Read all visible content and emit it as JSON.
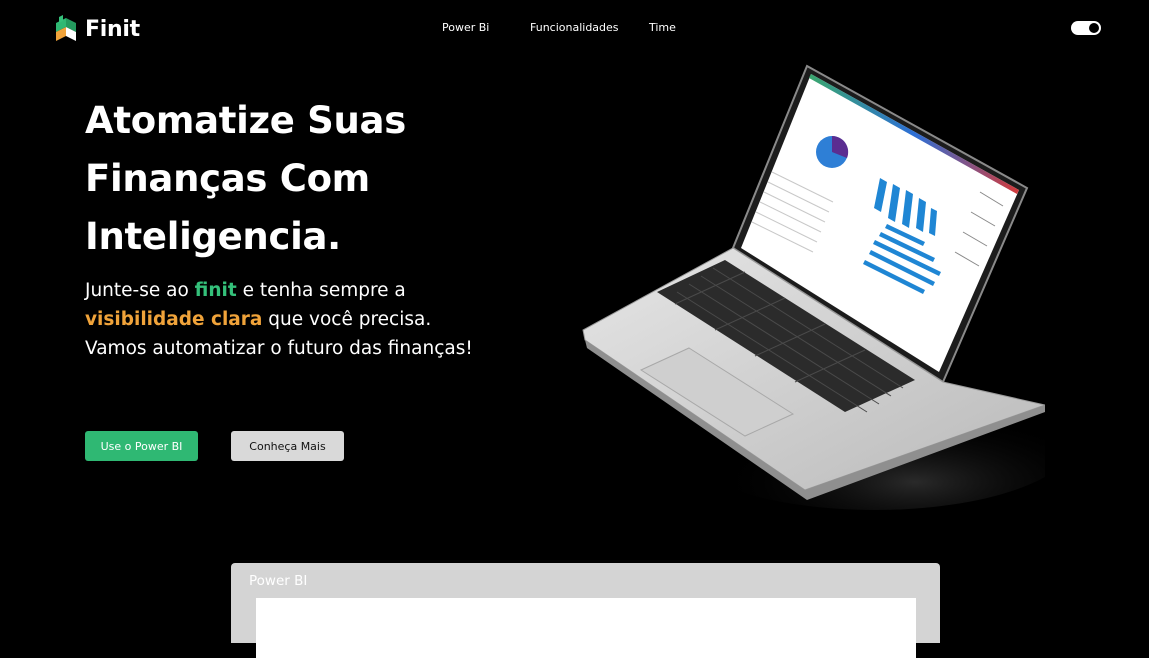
{
  "brand": {
    "name": "Finit",
    "logo_icon": "finit-logo-icon"
  },
  "nav": {
    "links": [
      "Power Bi",
      "Funcionalidades",
      "Time"
    ],
    "theme_toggle": "toggle-switch-icon"
  },
  "hero": {
    "headline": [
      "Atomatize Suas",
      "Finanças Com",
      "Inteligencia."
    ],
    "sub": {
      "l1_a": "Junte-se ao ",
      "l1_brand": "finit",
      "l1_b": " e tenha sempre a",
      "l2_hl": "visibilidade clara",
      "l2_b": " que você precisa.",
      "l3": "Vamos automatizar o futuro das finanças!"
    },
    "btn_primary": "Use o Power BI",
    "btn_secondary": "Conheça Mais",
    "image": "laptop-dashboard-image"
  },
  "section": {
    "title": "Power BI"
  },
  "colors": {
    "accent_green": "#34c07a",
    "accent_orange": "#f0a33a",
    "button_green": "#2fb873",
    "background": "#000000"
  }
}
